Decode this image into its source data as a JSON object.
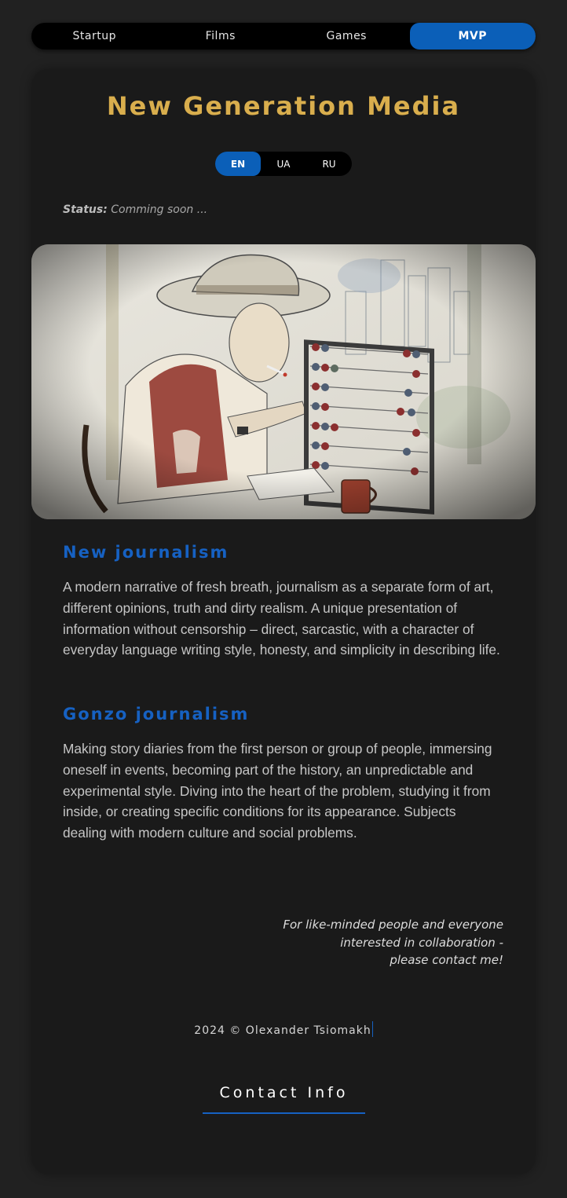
{
  "nav": {
    "tabs": [
      {
        "label": "Startup"
      },
      {
        "label": "Films"
      },
      {
        "label": "Games"
      },
      {
        "label": "MVP"
      }
    ],
    "active_index": 3
  },
  "header": {
    "title": "New Generation Media"
  },
  "languages": {
    "options": [
      "EN",
      "UA",
      "RU"
    ],
    "selected": "EN"
  },
  "status": {
    "label": "Status:",
    "value": "Comming soon ..."
  },
  "hero_image": {
    "subject": "watercolor sketch of a man in a hat and vest with a cigarette using an abacus"
  },
  "sections": [
    {
      "heading": "New journalism",
      "body": "A modern narrative of fresh breath, journalism as a separate form of art, different opinions, truth and dirty realism. A unique presentation of information without censorship – direct, sarcastic, with a character of everyday language writing style, honesty, and simplicity in describing life."
    },
    {
      "heading": "Gonzo journalism",
      "body": "Making story diaries from the first person or group of people, immersing oneself in events, becoming part of the history, an unpredictable and experimental style. Diving into the heart of the problem, studying it from inside, or creating specific conditions for its appearance. Subjects dealing with modern culture and social problems."
    }
  ],
  "collaboration": {
    "line1": "For like-minded people and everyone",
    "line2": "interested in collaboration -",
    "line3": "please contact me!"
  },
  "footer": {
    "copyright": "2024 © Olexander Tsiomakh",
    "contact_label": "Contact Info"
  },
  "colors": {
    "accent": "#0b5fb8",
    "heading_blue": "#1661c2",
    "title_gold": "#d9ae4d",
    "background": "#212121",
    "card": "#1a1a1a"
  }
}
